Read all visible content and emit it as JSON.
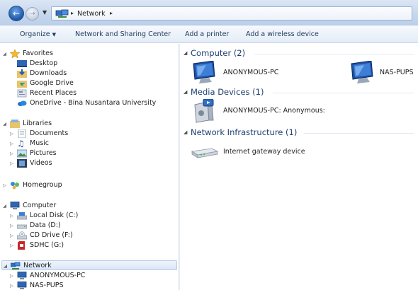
{
  "address_bar": {
    "location": "Network"
  },
  "command_bar": {
    "organize": "Organize",
    "network_sharing_center": "Network and Sharing Center",
    "add_printer": "Add a printer",
    "add_wireless_device": "Add a wireless device"
  },
  "nav": {
    "favorites": {
      "label": "Favorites",
      "items": [
        "Desktop",
        "Downloads",
        "Google Drive",
        "Recent Places",
        "OneDrive - Bina Nusantara University"
      ]
    },
    "libraries": {
      "label": "Libraries",
      "items": [
        "Documents",
        "Music",
        "Pictures",
        "Videos"
      ]
    },
    "homegroup": {
      "label": "Homegroup"
    },
    "computer": {
      "label": "Computer",
      "items": [
        "Local Disk (C:)",
        "Data (D:)",
        "CD Drive (F:)",
        "SDHC (G:)"
      ]
    },
    "network": {
      "label": "Network",
      "items": [
        "ANONYMOUS-PC",
        "NAS-PUPS"
      ]
    }
  },
  "content": {
    "groups": [
      {
        "title": "Computer (2)",
        "items": [
          "ANONYMOUS-PC",
          "NAS-PUPS"
        ]
      },
      {
        "title": "Media Devices (1)",
        "items": [
          "ANONYMOUS-PC: Anonymous:"
        ]
      },
      {
        "title": "Network Infrastructure (1)",
        "items": [
          "Internet gateway device"
        ]
      }
    ]
  },
  "colors": {
    "accent": "#1e3f74",
    "address_bar": "#c5d7ee",
    "selection": "#dbe8f7"
  },
  "icons": {
    "back": "back-arrow-icon",
    "forward": "forward-arrow-icon",
    "network": "network-icon",
    "monitor": "monitor-icon",
    "media_device": "media-device-icon",
    "router": "router-icon"
  }
}
